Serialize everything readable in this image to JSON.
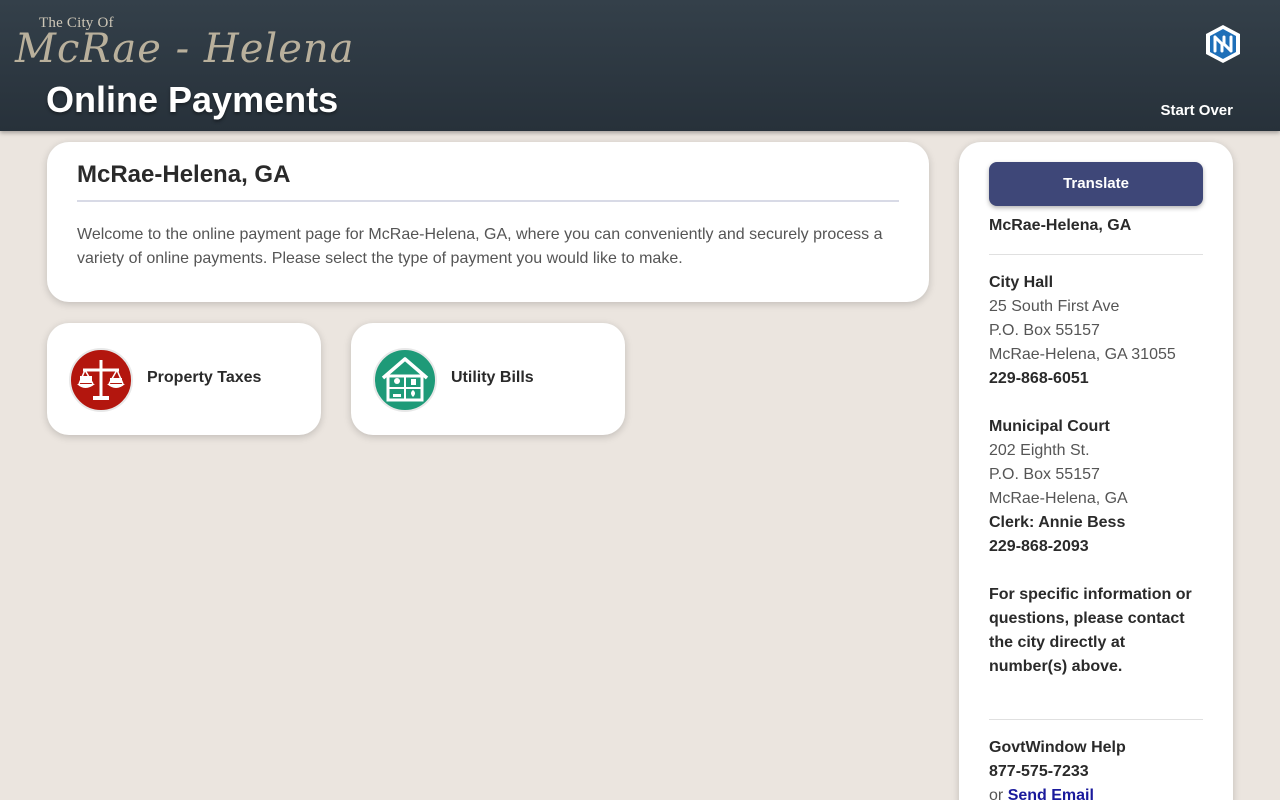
{
  "header": {
    "logo_line1": "The City Of",
    "logo_script": "McRae - Helena",
    "title": "Online Payments",
    "start_over": "Start Over",
    "brand_icon": "govtwindow-logo-icon"
  },
  "welcome": {
    "heading": "McRae-Helena, GA",
    "body": "Welcome to the online payment page for McRae-Helena, GA, where you can conveniently and securely process a variety of online payments. Please select the type of payment you would like to make."
  },
  "payments": [
    {
      "label": "Property Taxes",
      "icon": "scales-icon",
      "color": "#b3160e"
    },
    {
      "label": "Utility Bills",
      "icon": "house-utilities-icon",
      "color": "#1e9a78"
    }
  ],
  "sidebar": {
    "translate": "Translate",
    "city": "McRae-Helena, GA",
    "city_hall": {
      "title": "City Hall",
      "address1": "25 South First Ave",
      "address2": "P.O. Box 55157",
      "address3": "McRae-Helena, GA 31055",
      "phone": "229-868-6051"
    },
    "court": {
      "title": "Municipal Court",
      "address1": "202 Eighth St.",
      "address2": "P.O. Box 55157",
      "address3": "McRae-Helena, GA",
      "clerk": "Clerk: Annie Bess",
      "phone": "229-868-2093"
    },
    "note": "For specific information or questions, please contact the city directly at number(s) above.",
    "help": {
      "title": "GovtWindow Help",
      "phone": "877-575-7233",
      "or_text": "or",
      "email_link": "Send Email"
    }
  },
  "colors": {
    "header_bg": "#2e3841",
    "accent": "#3e4778",
    "page_bg": "#ebe5df"
  }
}
